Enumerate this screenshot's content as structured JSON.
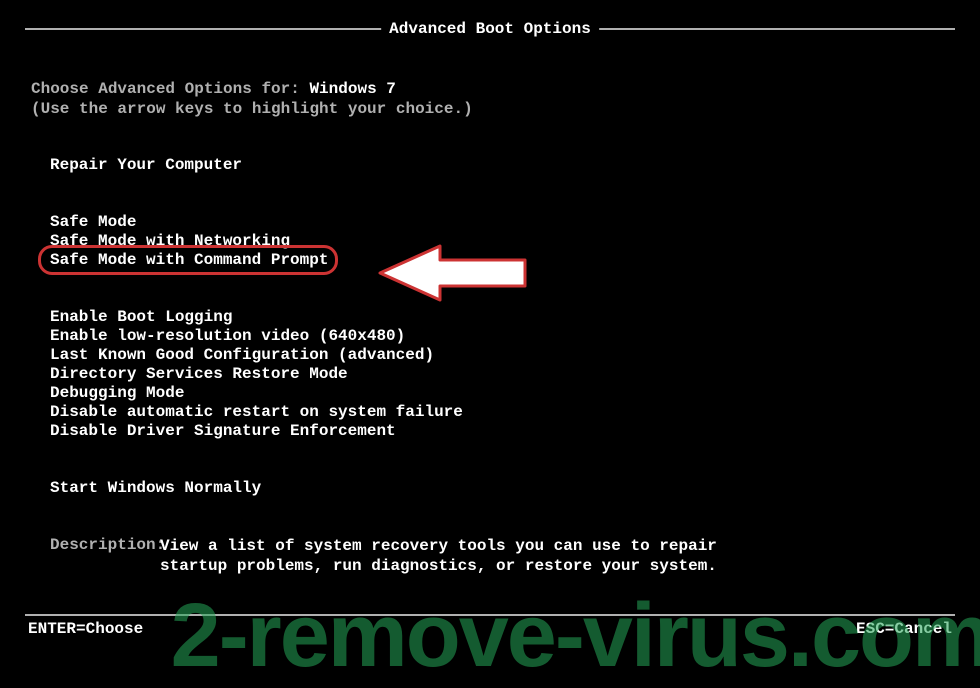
{
  "title": "Advanced Boot Options",
  "intro": {
    "prefix": "Choose Advanced Options for: ",
    "os": "Windows 7",
    "hint": "(Use the arrow keys to highlight your choice.)"
  },
  "groups": [
    {
      "items": [
        "Repair Your Computer"
      ]
    },
    {
      "items": [
        "Safe Mode",
        "Safe Mode with Networking",
        "Safe Mode with Command Prompt"
      ],
      "highlightIndex": 2
    },
    {
      "items": [
        "Enable Boot Logging",
        "Enable low-resolution video (640x480)",
        "Last Known Good Configuration (advanced)",
        "Directory Services Restore Mode",
        "Debugging Mode",
        "Disable automatic restart on system failure",
        "Disable Driver Signature Enforcement"
      ]
    },
    {
      "items": [
        "Start Windows Normally"
      ]
    }
  ],
  "description": {
    "label": "Description:",
    "text": "View a list of system recovery tools you can use to repair startup problems, run diagnostics, or restore your system."
  },
  "footer": {
    "left": "ENTER=Choose",
    "right": "ESC=Cancel"
  },
  "watermark": "2-remove-virus.com"
}
